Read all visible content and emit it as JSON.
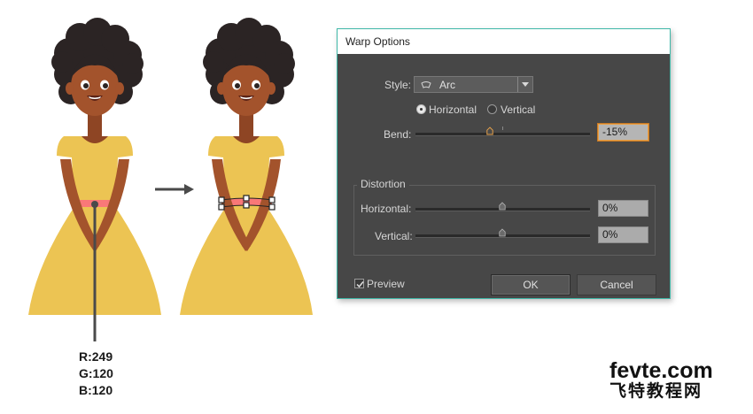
{
  "illustration": {
    "color_readout": {
      "r": "R:249",
      "g": "G:120",
      "b": "B:120"
    },
    "colors": {
      "hair": "#2b2424",
      "skin": "#a3532c",
      "dress": "#ecc453",
      "belt": "#f97878",
      "arrow": "#4a4a4a"
    }
  },
  "dialog": {
    "title": "Warp Options",
    "style_label": "Style:",
    "style_value": "Arc",
    "style_icon": "arc-warp-icon",
    "orientation": {
      "horizontal_label": "Horizontal",
      "vertical_label": "Vertical",
      "selected": "Horizontal"
    },
    "bend": {
      "label": "Bend:",
      "value": "-15%",
      "level": -15
    },
    "distortion": {
      "group_label": "Distortion",
      "horizontal_label": "Horizontal:",
      "horizontal_value": "0%",
      "vertical_label": "Vertical:",
      "vertical_value": "0%"
    },
    "preview": {
      "label": "Preview",
      "checked": true
    },
    "ok_label": "OK",
    "cancel_label": "Cancel"
  },
  "watermark": {
    "line1": "fevte.com",
    "line2": "飞特教程网"
  }
}
